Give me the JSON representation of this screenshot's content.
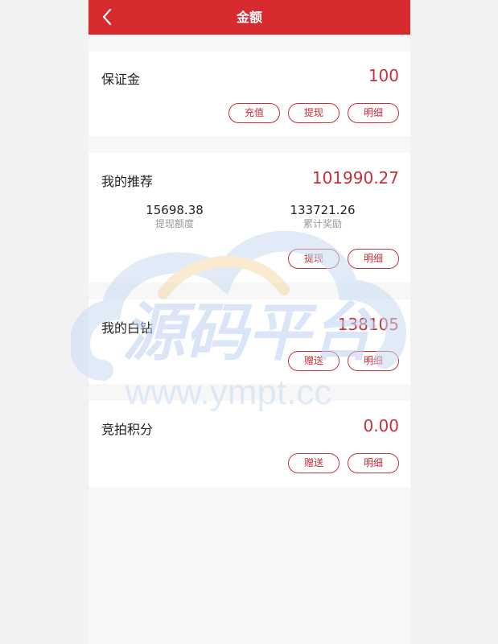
{
  "header": {
    "title": "金额"
  },
  "deposit": {
    "title": "保证金",
    "amount": "100",
    "buttons": [
      "充值",
      "提现",
      "明细"
    ]
  },
  "referral": {
    "title": "我的推荐",
    "amount": "101990.27",
    "stats": [
      {
        "value": "15698.38",
        "label": "提现额度"
      },
      {
        "value": "133721.26",
        "label": "累计奖励"
      }
    ],
    "buttons": [
      "提现",
      "明细"
    ]
  },
  "diamond": {
    "title": "我的白钻",
    "amount": "138105",
    "buttons": [
      "赠送",
      "明细"
    ]
  },
  "auction_points": {
    "title": "竞拍积分",
    "amount": "0.00",
    "buttons": [
      "赠送",
      "明细"
    ]
  },
  "watermark": {
    "brand": "源码平台",
    "url": "www.ympt.cc"
  },
  "colors": {
    "header_bg": "#d62a2e",
    "accent": "#c8303a"
  }
}
